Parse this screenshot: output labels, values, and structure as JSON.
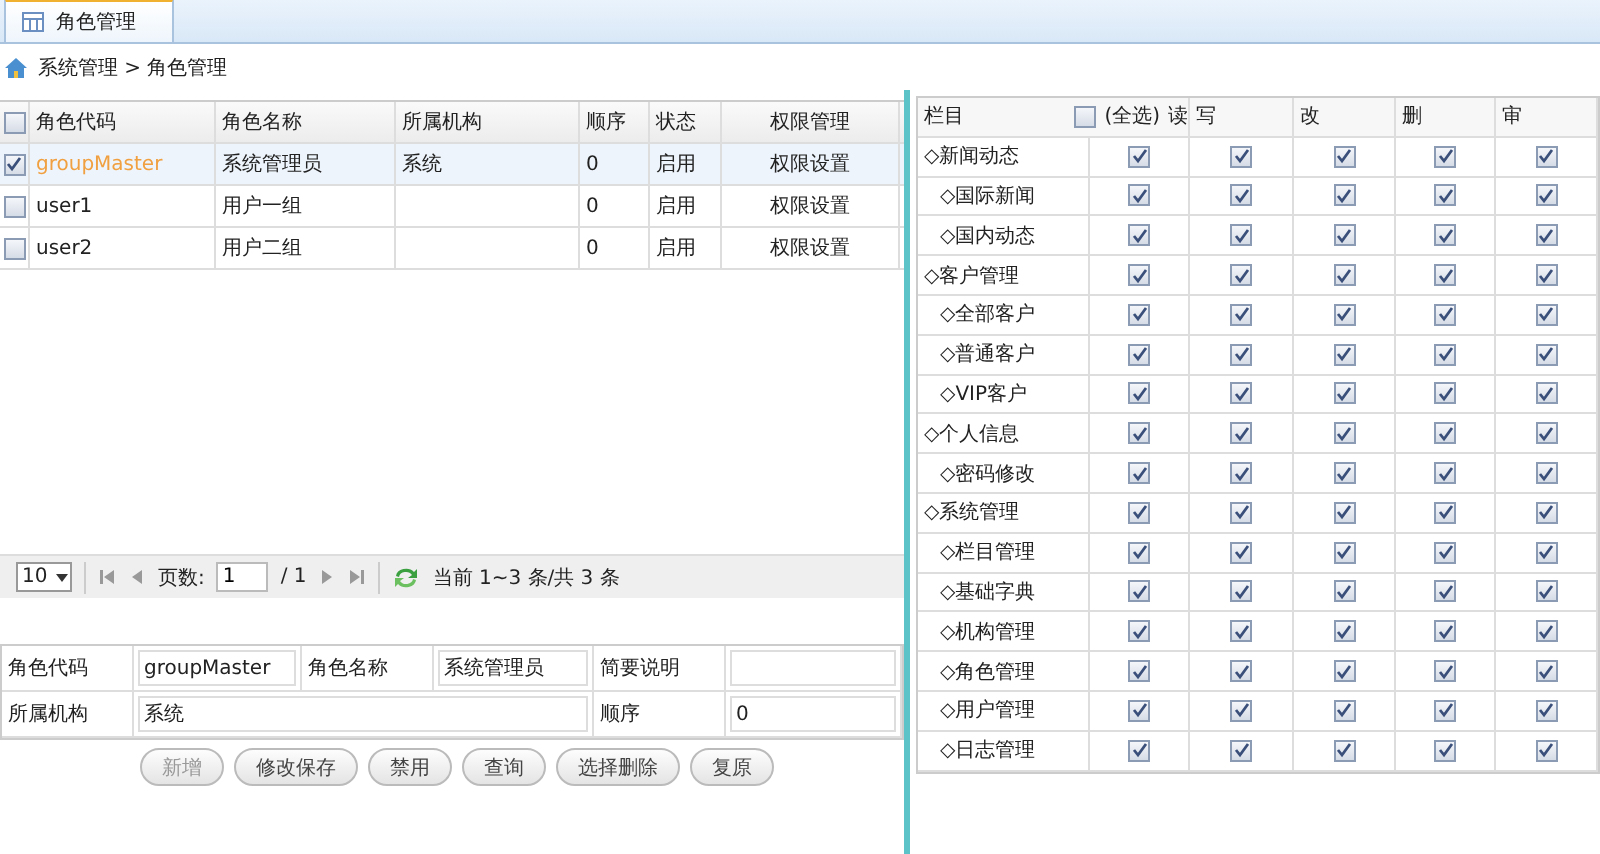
{
  "tab": {
    "label": "角色管理",
    "selected": true
  },
  "breadcrumb": "系统管理 > 角色管理",
  "roles": {
    "select_all": false,
    "columns": [
      "角色代码",
      "角色名称",
      "所属机构",
      "顺序",
      "状态",
      "权限管理"
    ],
    "rows": [
      {
        "selected": true,
        "checked": true,
        "code": "groupMaster",
        "name": "系统管理员",
        "org": "系统",
        "order": "0",
        "status": "启用",
        "action": "权限设置"
      },
      {
        "selected": false,
        "checked": false,
        "code": "user1",
        "name": "用户一组",
        "org": "",
        "order": "0",
        "status": "启用",
        "action": "权限设置"
      },
      {
        "selected": false,
        "checked": false,
        "code": "user2",
        "name": "用户二组",
        "org": "",
        "order": "0",
        "status": "启用",
        "action": "权限设置"
      }
    ]
  },
  "pager": {
    "page_size": "10",
    "page_label": "页数:",
    "page": "1",
    "total_pages": "/ 1",
    "summary": "当前 1~3 条/共 3 条"
  },
  "form": [
    [
      {
        "label": "角色代码",
        "value": "groupMaster"
      },
      {
        "label": "角色名称",
        "value": "系统管理员"
      },
      {
        "label": "简要说明"
      }
    ],
    [
      {
        "label": "所属机构",
        "value": "系统"
      },
      {
        "label": "顺序",
        "value": "0"
      }
    ]
  ],
  "buttons": [
    {
      "label": "新增",
      "disabled": true
    },
    {
      "label": "修改保存",
      "disabled": false
    },
    {
      "label": "禁用",
      "disabled": false
    },
    {
      "label": "查询",
      "disabled": false
    },
    {
      "label": "选择删除",
      "disabled": false
    },
    {
      "label": "复原",
      "disabled": false
    }
  ],
  "permissions": {
    "first_column": "栏目",
    "select_all": {
      "label": "(全选)",
      "checked": false
    },
    "columns": [
      "读",
      "写",
      "改",
      "删",
      "审"
    ],
    "sections": [
      {
        "label": "◇新闻动态",
        "checked": [
          true,
          true,
          true,
          true,
          true
        ],
        "children": [
          {
            "label": "◇国际新闻",
            "checked": [
              true,
              true,
              true,
              true,
              true
            ]
          },
          {
            "label": "◇国内动态",
            "checked": [
              true,
              true,
              true,
              true,
              true
            ]
          }
        ]
      },
      {
        "label": "◇客户管理",
        "checked": [
          true,
          true,
          true,
          true,
          true
        ],
        "children": [
          {
            "label": "◇全部客户",
            "checked": [
              true,
              true,
              true,
              true,
              true
            ]
          },
          {
            "label": "◇普通客户",
            "checked": [
              true,
              true,
              true,
              true,
              true
            ]
          },
          {
            "label": "◇VIP客户",
            "checked": [
              true,
              true,
              true,
              true,
              true
            ]
          }
        ]
      },
      {
        "label": "◇个人信息",
        "checked": [
          true,
          true,
          true,
          true,
          true
        ],
        "children": [
          {
            "label": "◇密码修改",
            "checked": [
              true,
              true,
              true,
              true,
              true
            ]
          }
        ]
      },
      {
        "label": "◇系统管理",
        "checked": [
          true,
          true,
          true,
          true,
          true
        ],
        "children": [
          {
            "label": "◇栏目管理",
            "checked": [
              true,
              true,
              true,
              true,
              true
            ]
          },
          {
            "label": "◇基础字典",
            "checked": [
              true,
              true,
              true,
              true,
              true
            ]
          },
          {
            "label": "◇机构管理",
            "checked": [
              true,
              true,
              true,
              true,
              true
            ]
          },
          {
            "label": "◇角色管理",
            "checked": [
              true,
              true,
              true,
              true,
              true
            ]
          },
          {
            "label": "◇用户管理",
            "checked": [
              true,
              true,
              true,
              true,
              true
            ]
          },
          {
            "label": "◇日志管理",
            "checked": [
              true,
              true,
              true,
              true,
              true
            ]
          }
        ]
      }
    ]
  }
}
